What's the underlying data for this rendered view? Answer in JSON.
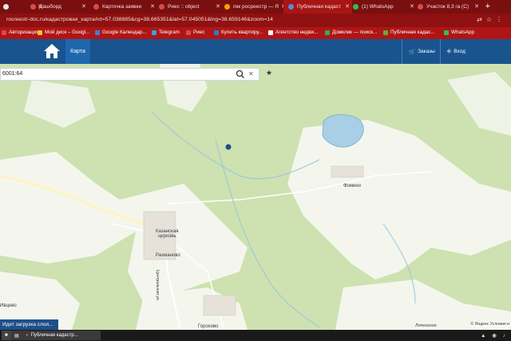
{
  "browser": {
    "tabs": [
      {
        "title": "",
        "favicon_color": "#e8e8e8",
        "active": false
      },
      {
        "title": "Дашборд",
        "favicon_color": "#d94b4b",
        "active": false
      },
      {
        "title": "Карточка заявки",
        "favicon_color": "#d94b4b",
        "active": false
      },
      {
        "title": "Риес :: object",
        "favicon_color": "#d94b4b",
        "active": false
      },
      {
        "title": "пкк росреестр — Я",
        "favicon_color": "#f5a300",
        "active": false
      },
      {
        "title": "Публичная кадаст",
        "favicon_color": "#5b8cd6",
        "active": true
      },
      {
        "title": "(1) WhatsApp",
        "favicon_color": "#2fbf4c",
        "active": false
      },
      {
        "title": "Участок 8,3 га (С)",
        "favicon_color": "#d94b4b",
        "active": false
      }
    ],
    "address": "rosreestr-doc.ru/кадастровая_карта#ct=57.038885&cg=38.665351&lat=57.045051&lng=38.659146&zoom=14",
    "bookmarks": [
      {
        "label": "Авторизация",
        "icon_color": "#d94b4b"
      },
      {
        "label": "Мой диск – Googl...",
        "icon_color": "#f2c230"
      },
      {
        "label": "Google Календар...",
        "icon_color": "#3b7de0"
      },
      {
        "label": "Telegram",
        "icon_color": "#33a3e0"
      },
      {
        "label": "Риес",
        "icon_color": "#d94b4b"
      },
      {
        "label": "Купить квартиру...",
        "icon_color": "#2b7bd0"
      },
      {
        "label": "Агентство недви...",
        "icon_color": "#ffffff"
      },
      {
        "label": "Домклик — поиск...",
        "icon_color": "#2fae5a"
      },
      {
        "label": "Публичная кадас...",
        "icon_color": "#5fae3a"
      },
      {
        "label": "WhatsApp",
        "icon_color": "#2fbf4c"
      }
    ]
  },
  "site": {
    "nav_map": "Карта",
    "orders": "Заказы",
    "login": "Вход",
    "search_value": "6001:64"
  },
  "map": {
    "places": [
      {
        "name": "Казанская церковь",
        "line1": "Казанская",
        "line2": "церковь"
      },
      {
        "name": "Рахманово"
      },
      {
        "name": "Фомино"
      },
      {
        "name": "Горохово"
      },
      {
        "name": "Ивцево"
      },
      {
        "name": "Центральная ул."
      },
      {
        "name": "Лоченское"
      }
    ],
    "loading_text": "Идет загрузка слоя...",
    "copyright": "© Яндекс Условия и"
  },
  "taskbar": {
    "task": "Публичная кадастр..."
  },
  "colors": {
    "tabbar": "#7a0f0f",
    "bookmarks": "#b01515",
    "site_header": "#19548f",
    "forest": "#cde2b0",
    "field": "#f4f6ee"
  }
}
